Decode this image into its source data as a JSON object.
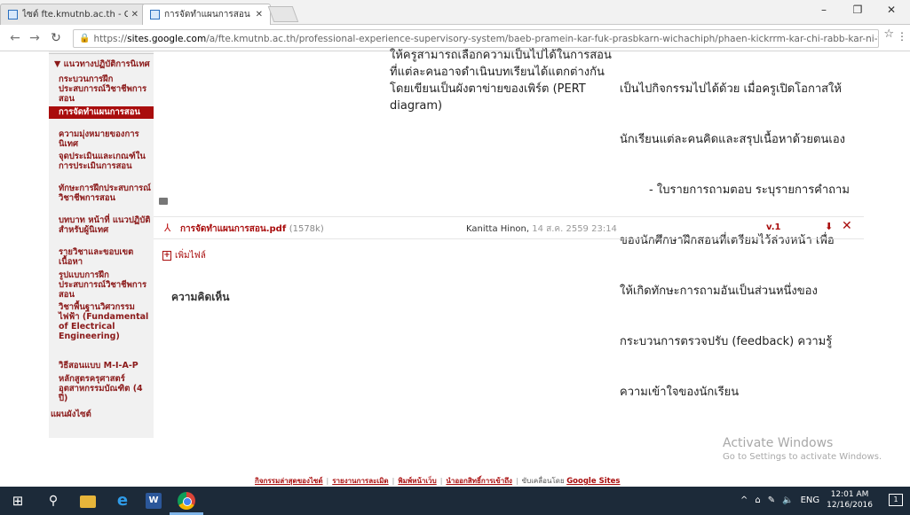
{
  "browser": {
    "tabs": [
      {
        "title": "ไซต์ fte.kmutnb.ac.th - Go"
      },
      {
        "title": "การจัดทำแผนการสอน - PRO"
      }
    ],
    "url_scheme": "https://",
    "url_host": "sites.google.com",
    "url_path": "/a/fte.kmutnb.ac.th/professional-experience-supervisory-system/baeb-pramein-kar-fuk-prasbkarn-wichachiph/phaen-kickrrm-kar-chi-rabb-kar-ni-the-sx-xnlin"
  },
  "sidebar": {
    "category": "▼ แนวทางปฏิบัติการนิเทศ",
    "items": [
      "กระบวนการฝึกประสบการณ์วิชาชีพการสอน",
      "การจัดทำแผนการสอน",
      "ความมุ่งหมายของการนิเทศ",
      "จุดประเมินและเกณฑ์ในการประเมินการสอน",
      "ทักษะการฝึกประสบการณ์วิชาชีพการสอน",
      "บทบาท หน้าที่ แนวปฏิบัติสำหรับผู้นิเทศ",
      "รายวิชาและขอบเขตเนื้อหา",
      "รูปแบบการฝึกประสบการณ์วิชาชีพการสอน",
      "วิชาพื้นฐานวิศวกรรมไฟฟ้า (Fundamental of Electrical Engineering)",
      "วิธีสอนแบบ M-I-A-P",
      "หลักสูตรครุศาสตร์อุตสาหกรรมบัณฑิต (4 ปี)"
    ],
    "sitemap": "แผนผังไซต์"
  },
  "content": {
    "col1": [
      "ให้ครูสามารถเลือกความเป็นไปได้ในการสอน",
      "ที่แต่ละคนอาจดำเนินบทเรียนได้แตกต่างกัน",
      "โดยเขียนเป็นผังตาข่ายของเพิร์ต (PERT",
      "diagram)"
    ],
    "col2": [
      "เป็นไปกิจกรรมไปได้ด้วย เมื่อครูเปิดโอกาสให้",
      "นักเรียนแต่ละคนคิดและสรุปเนื้อหาด้วยตนเอง",
      "        - ใบรายการถามตอบ ระบุรายการคำถาม",
      "ของนักศึกษาฝึกสอนที่เตรียมไว้ล่วงหน้า เพื่อ",
      "ให้เกิดทักษะการถามอันเป็นส่วนหนึ่งของ",
      "กระบวนการตรวจปรับ (feedback) ความรู้",
      "ความเข้าใจของนักเรียน"
    ]
  },
  "attachment": {
    "file_name": "การจัดทำแผนการสอน.pdf",
    "file_size": "(1578k)",
    "uploader": "Kanitta Hinon,",
    "date": "14 ส.ค. 2559 23:14",
    "version": "v.1"
  },
  "add_file_label": "เพิ่มไฟล์",
  "comments_heading": "ความคิดเห็น",
  "watermark": {
    "line1": "Activate Windows",
    "line2": "Go to Settings to activate Windows."
  },
  "footer": {
    "links": [
      "กิจกรรมล่าสุดของไซต์",
      "รายงานการละเมิด",
      "พิมพ์หน้าเว็บ",
      "นำออกสิทธิ์การเข้าถึง"
    ],
    "powered_by": "ขับเคลื่อนโดย",
    "google_sites": "Google Sites"
  },
  "taskbar": {
    "lang": "ENG",
    "time": "12:01 AM",
    "date": "12/16/2016"
  }
}
